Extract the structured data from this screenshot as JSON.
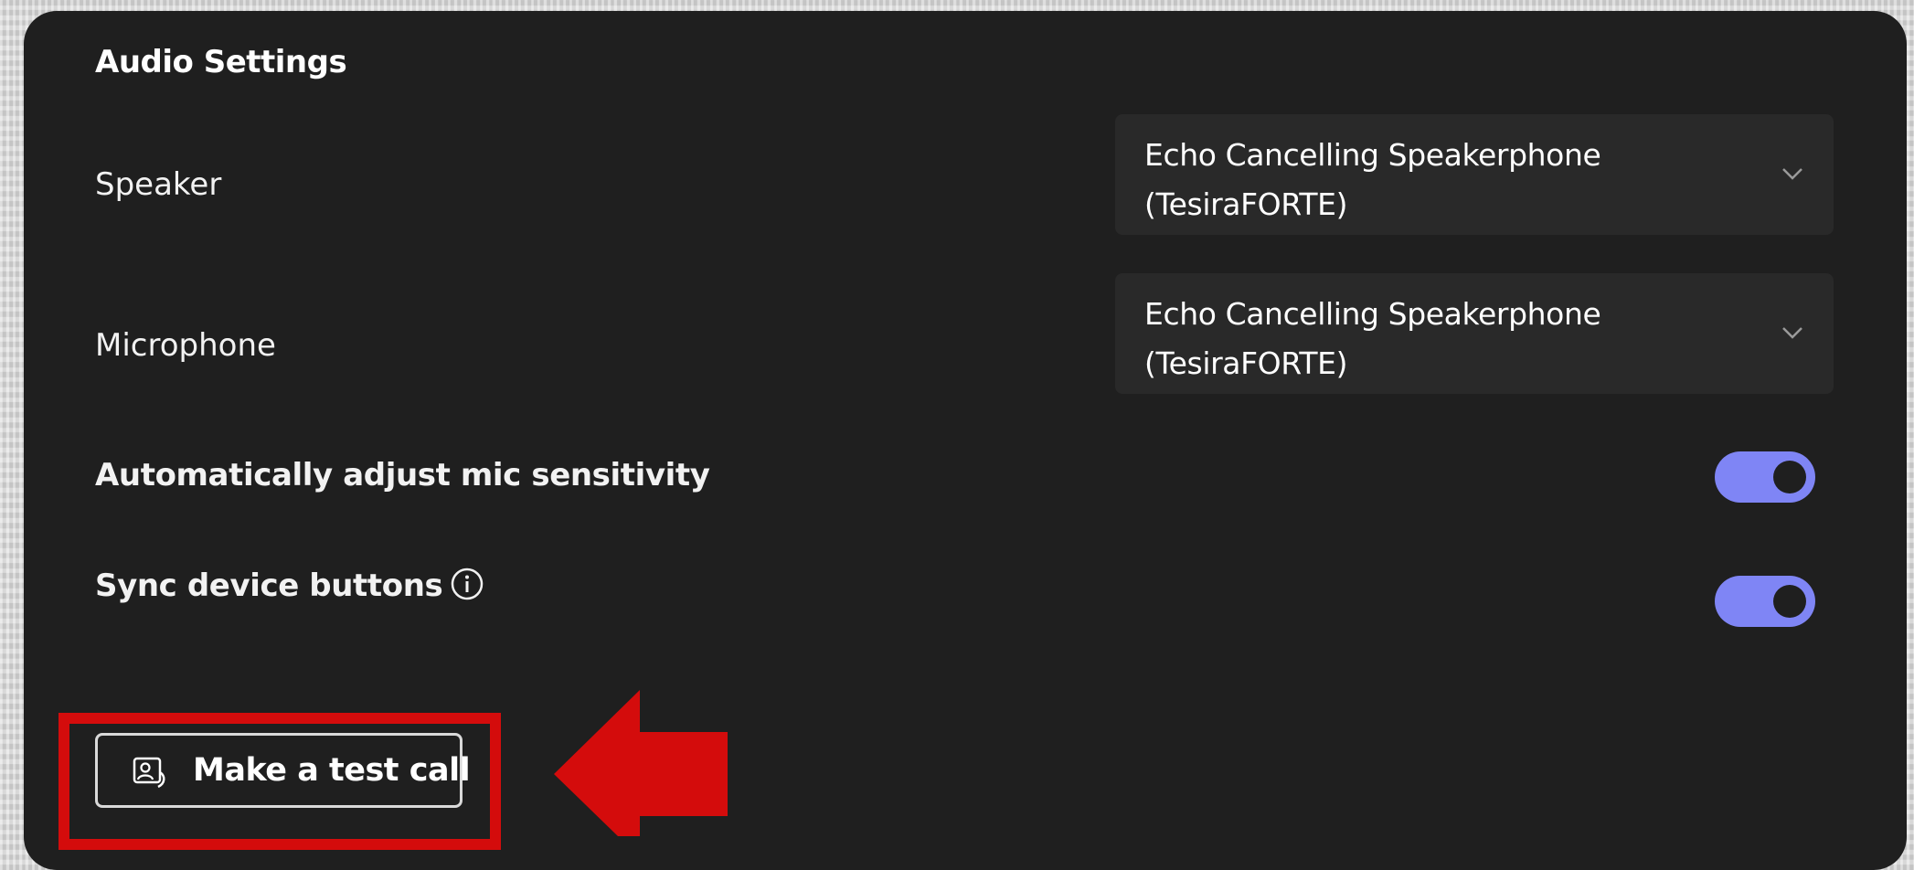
{
  "audio_settings": {
    "title": "Audio Settings",
    "speaker": {
      "label": "Speaker",
      "value_line1": "Echo Cancelling Speakerphone",
      "value_line2": "(TesiraFORTE)",
      "icon": "chevron-down-icon"
    },
    "microphone": {
      "label": "Microphone",
      "value_line1": "Echo Cancelling Speakerphone",
      "value_line2": "(TesiraFORTE)",
      "icon": "chevron-down-icon"
    },
    "auto_adjust": {
      "label": "Automatically adjust mic sensitivity",
      "enabled": true
    },
    "sync_buttons": {
      "label": "Sync device buttons",
      "info_icon": "info-icon",
      "enabled": true
    },
    "test_call": {
      "label": "Make a test call",
      "icon": "test-call-icon"
    }
  },
  "annotation": {
    "highlight_color": "#d40c0c",
    "arrow_icon": "left-arrow-icon"
  },
  "colors": {
    "panel_bg": "#1f1f1f",
    "dropdown_bg": "#292929",
    "toggle_on": "#7f85f5"
  }
}
